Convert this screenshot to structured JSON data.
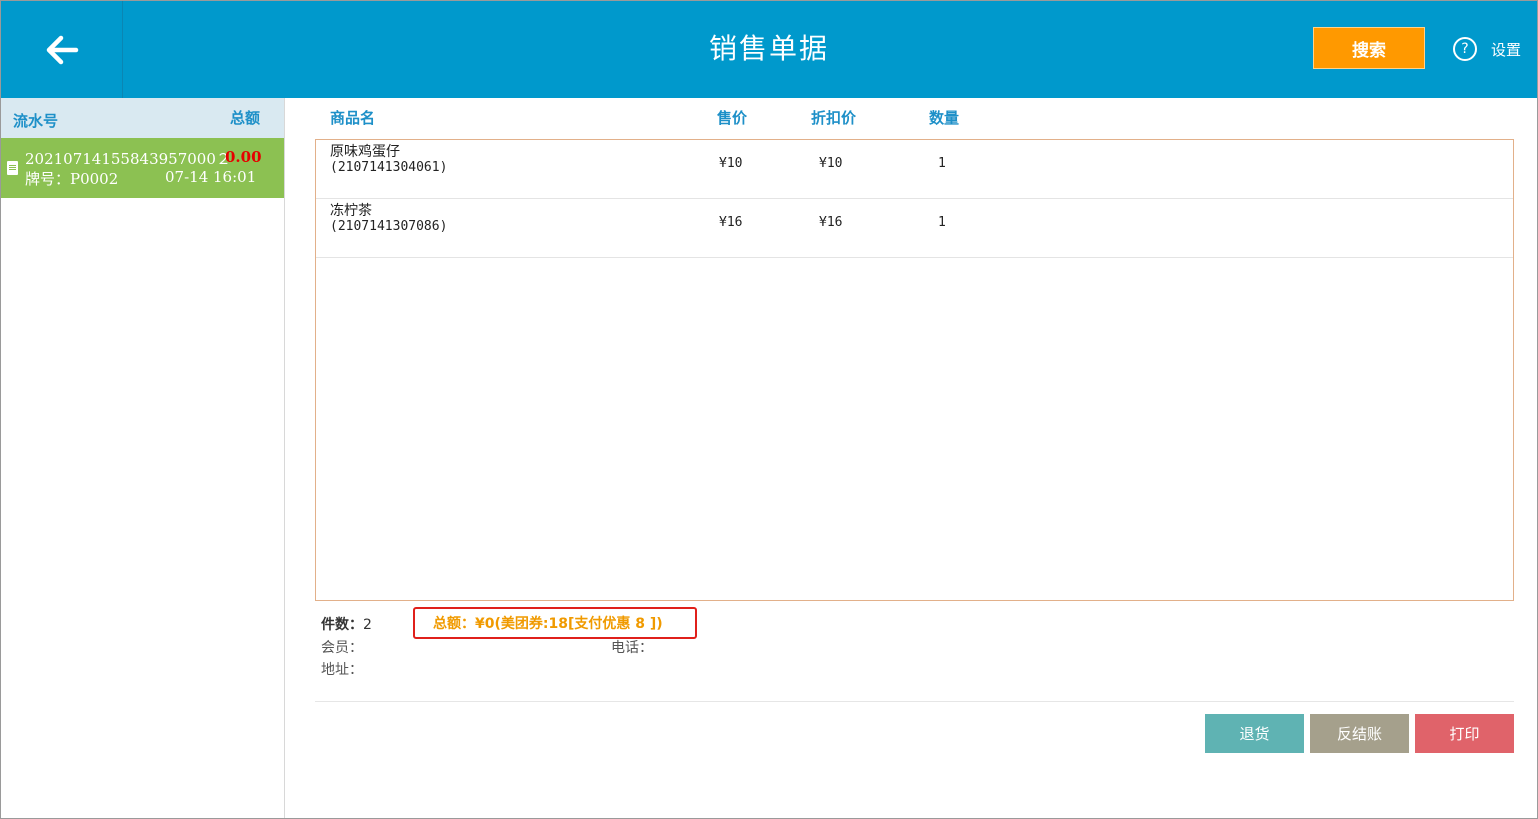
{
  "header": {
    "title": "销售单据",
    "search_label": "搜索",
    "settings_label": "设置",
    "help_glyph": "?"
  },
  "left_panel": {
    "col_serial": "流水号",
    "col_total": "总额",
    "records": [
      {
        "serial": "20210714155843957000２",
        "amount": "0.00",
        "plate": "牌号：P0002",
        "time": "07-14 16:01"
      }
    ]
  },
  "columns": {
    "name": "商品名",
    "price": "售价",
    "discount_price": "折扣价",
    "quantity": "数量"
  },
  "items": [
    {
      "name": "原味鸡蛋仔",
      "code": "(2107141304061)",
      "price": "¥10",
      "discount_price": "¥10",
      "quantity": "1"
    },
    {
      "name": "冻柠茶",
      "code": "(2107141307086)",
      "price": "¥16",
      "discount_price": "¥16",
      "quantity": "1"
    }
  ],
  "summary": {
    "count_label": "件数：",
    "count_value": "2",
    "total_text": "总额：¥0(美团券:18[支付优惠 8 ])",
    "member_label": "会员：",
    "phone_label": "电话：",
    "address_label": "地址："
  },
  "actions": {
    "return_label": "退货",
    "reverse_label": "反结账",
    "print_label": "打印"
  },
  "colors": {
    "header": "#0099cc",
    "search": "#ff9900",
    "record_selected": "#8cc152",
    "amount": "#e60000",
    "total_highlight": "#f09a00",
    "return_btn": "#5fb3b3",
    "reverse_btn": "#a5a08c",
    "print_btn": "#e0636a"
  }
}
